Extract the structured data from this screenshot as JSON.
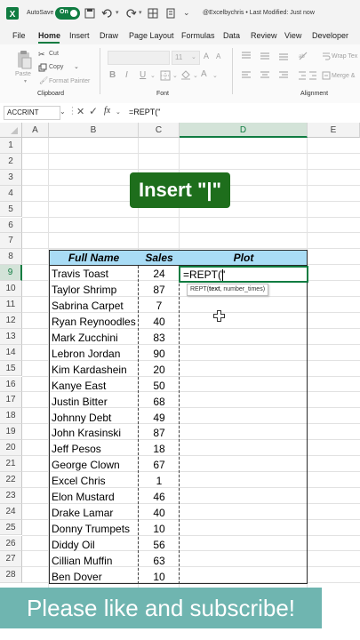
{
  "title_bar": {
    "autosave_label": "AutoSave",
    "toggle_label": "On",
    "doc_title": "@Excelbychris • Last Modified: Just now"
  },
  "ribbon_tabs": [
    "File",
    "Home",
    "Insert",
    "Draw",
    "Page Layout",
    "Formulas",
    "Data",
    "Review",
    "View",
    "Developer"
  ],
  "active_tab": "Home",
  "clipboard": {
    "paste": "Paste",
    "cut": "Cut",
    "copy": "Copy",
    "format_painter": "Format Painter",
    "group": "Clipboard"
  },
  "font": {
    "size": "11",
    "group": "Font",
    "bold": "B",
    "italic": "I",
    "underline": "U"
  },
  "alignment": {
    "wrap_text": "Wrap Tex",
    "merge": "Merge &",
    "group": "Alignment"
  },
  "formula_bar": {
    "name_box": "ACCRINT",
    "fx": "fx",
    "content": "=REPT(\""
  },
  "columns": [
    "A",
    "B",
    "C",
    "D",
    "E"
  ],
  "rows": [
    "1",
    "2",
    "3",
    "4",
    "5",
    "6",
    "7",
    "8",
    "9",
    "10",
    "11",
    "12",
    "13",
    "14",
    "15",
    "16",
    "17",
    "18",
    "19",
    "20",
    "21",
    "22",
    "23",
    "24",
    "25",
    "26",
    "27",
    "28"
  ],
  "banner": "Insert \"|\"",
  "table": {
    "headers": [
      "Full Name",
      "Sales",
      "Plot"
    ],
    "rows": [
      {
        "name": "Travis Toast",
        "sales": "24"
      },
      {
        "name": "Taylor Shrimp",
        "sales": "87"
      },
      {
        "name": "Sabrina Carpet",
        "sales": "7"
      },
      {
        "name": "Ryan Reynoodles",
        "sales": "40"
      },
      {
        "name": "Mark Zucchini",
        "sales": "83"
      },
      {
        "name": "Lebron Jordan",
        "sales": "90"
      },
      {
        "name": "Kim Kardashein",
        "sales": "20"
      },
      {
        "name": "Kanye East",
        "sales": "50"
      },
      {
        "name": "Justin Bitter",
        "sales": "68"
      },
      {
        "name": "Johnny Debt",
        "sales": "49"
      },
      {
        "name": "John Krasinski",
        "sales": "87"
      },
      {
        "name": "Jeff Pesos",
        "sales": "18"
      },
      {
        "name": "George Clown",
        "sales": "67"
      },
      {
        "name": "Excel Chris",
        "sales": "1"
      },
      {
        "name": "Elon Mustard",
        "sales": "46"
      },
      {
        "name": "Drake Lamar",
        "sales": "40"
      },
      {
        "name": "Donny Trumpets",
        "sales": "10"
      },
      {
        "name": "Diddy Oil",
        "sales": "56"
      },
      {
        "name": "Cillian Muffin",
        "sales": "63"
      },
      {
        "name": "Ben Dover",
        "sales": "10"
      }
    ]
  },
  "editing_cell": "=REPT(\"",
  "tooltip": {
    "fn": "REPT(",
    "arg1": "text",
    "rest": ", number_times)"
  },
  "subscribe_banner": "Please like and subscribe!",
  "colors": {
    "excel_green": "#107c41",
    "header_fill": "#a9dcf5",
    "banner_green": "#1e6e1c",
    "teal_banner": "#6fb5b0"
  }
}
